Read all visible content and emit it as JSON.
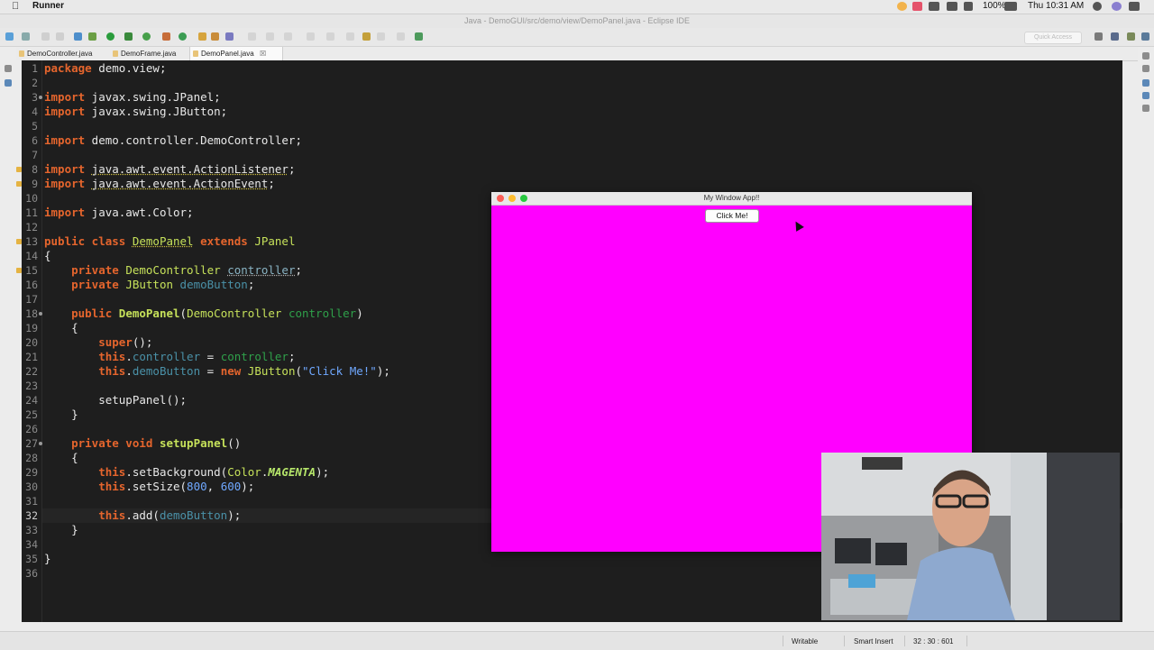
{
  "menubar": {
    "app_name": "Runner",
    "clock": "Thu 10:31 AM",
    "battery": "100%"
  },
  "window": {
    "title": "Java - DemoGUI/src/demo/view/DemoPanel.java - Eclipse IDE"
  },
  "toolbar": {
    "quick_access_placeholder": "Quick Access"
  },
  "tabs": [
    {
      "label": "DemoController.java",
      "active": false
    },
    {
      "label": "DemoFrame.java",
      "active": false
    },
    {
      "label": "DemoPanel.java",
      "active": true,
      "close": "☒"
    }
  ],
  "editor": {
    "lines": [
      "1",
      "2",
      "3",
      "4",
      "5",
      "6",
      "7",
      "8",
      "9",
      "10",
      "11",
      "12",
      "13",
      "14",
      "15",
      "16",
      "17",
      "18",
      "19",
      "20",
      "21",
      "22",
      "23",
      "24",
      "25",
      "26",
      "27",
      "28",
      "29",
      "30",
      "31",
      "32",
      "33",
      "34",
      "35",
      "36"
    ],
    "current_line": "32"
  },
  "code": {
    "l1": [
      "package",
      " demo.view;"
    ],
    "l3": [
      "import",
      " javax.swing.JPanel;"
    ],
    "l4": [
      "import",
      " javax.swing.JButton;"
    ],
    "l6": [
      "import",
      " demo.controller.DemoController;"
    ],
    "l8": [
      "import",
      " ",
      "java.awt.event.ActionListener",
      ";"
    ],
    "l9": [
      "import",
      " ",
      "java.awt.event.ActionEvent",
      ";"
    ],
    "l11": [
      "import",
      " java.awt.Color;"
    ],
    "l13": [
      "public class",
      " ",
      "DemoPanel",
      " ",
      "extends",
      " ",
      "JPanel"
    ],
    "l14": "{",
    "l15": [
      "    private",
      " ",
      "DemoController",
      " ",
      "controller",
      ";"
    ],
    "l16": [
      "    private",
      " ",
      "JButton",
      " ",
      "demoButton",
      ";"
    ],
    "l18": [
      "    public",
      " ",
      "DemoPanel",
      "(",
      "DemoController",
      " ",
      "controller",
      ")"
    ],
    "l19": "    {",
    "l20": [
      "        super",
      "();"
    ],
    "l21": [
      "        this",
      ".",
      "controller",
      " = ",
      "controller",
      ";"
    ],
    "l22": [
      "        this",
      ".",
      "demoButton",
      " = ",
      "new",
      " ",
      "JButton",
      "(",
      "\"Click Me!\"",
      ");"
    ],
    "l24": "        setupPanel();",
    "l25": "    }",
    "l27": [
      "    private void",
      " ",
      "setupPanel",
      "()"
    ],
    "l28": "    {",
    "l29": [
      "        this",
      ".setBackground(",
      "Color",
      ".",
      "MAGENTA",
      ");"
    ],
    "l30": [
      "        this",
      ".setSize(",
      "800",
      ", ",
      "600",
      ");"
    ],
    "l32": [
      "        this",
      ".add(",
      "demoButton",
      ");"
    ],
    "l33": "    }",
    "l35": "}"
  },
  "app_window": {
    "title": "My Window App!!",
    "button_label": "Click Me!",
    "background_color": "#ff00ff"
  },
  "status": {
    "writable": "Writable",
    "insert_mode": "Smart Insert",
    "position": "32 : 30 : 601"
  },
  "colors": {
    "keyword": "#e5652d",
    "type": "#c6e15a",
    "field": "#4a91a8",
    "string": "#6fa8ff",
    "editor_bg": "#1e1e1e"
  }
}
